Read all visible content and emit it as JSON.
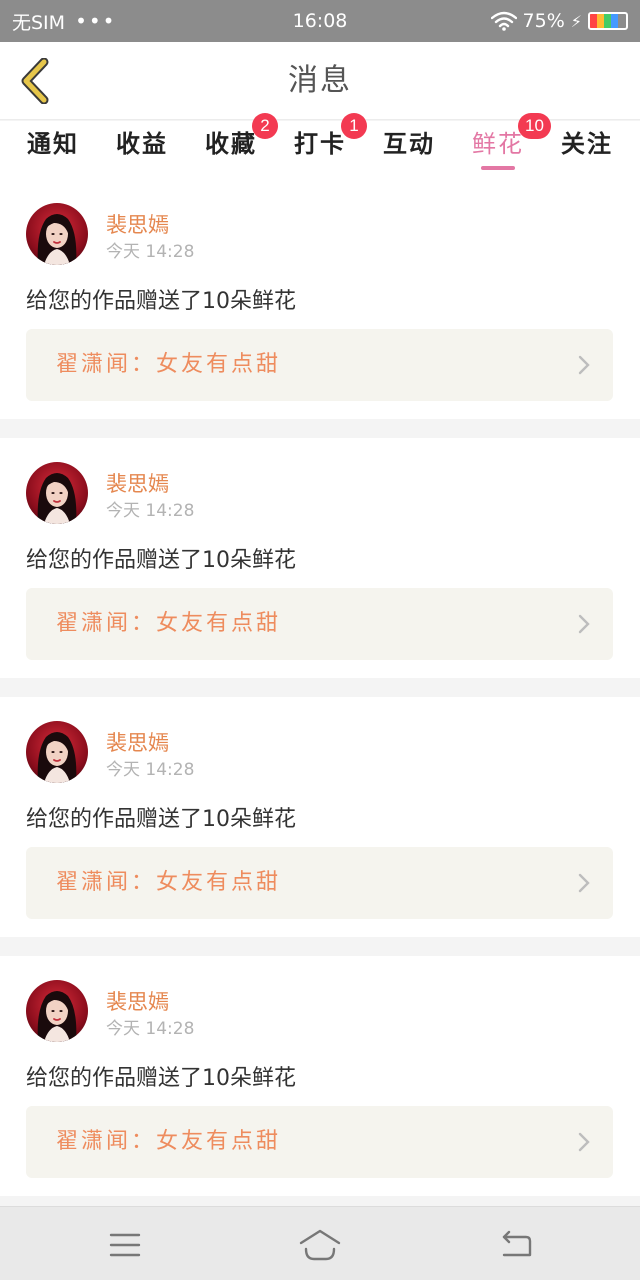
{
  "status_bar": {
    "carrier": "无SIM",
    "dots": "•••",
    "time": "16:08",
    "battery_percent": "75%"
  },
  "header": {
    "title": "消息",
    "back_icon": "chevron-left-icon"
  },
  "tabs": [
    {
      "label": "通知",
      "badge": ""
    },
    {
      "label": "收益",
      "badge": ""
    },
    {
      "label": "收藏",
      "badge": "2"
    },
    {
      "label": "打卡",
      "badge": "1"
    },
    {
      "label": "互动",
      "badge": ""
    },
    {
      "label": "鲜花",
      "badge": "10",
      "active": true
    },
    {
      "label": "关注",
      "badge": ""
    }
  ],
  "feed": [
    {
      "user": "裴思嫣",
      "time": "今天 14:28",
      "message": "给您的作品赠送了10朵鲜花",
      "work": "翟潇闻：女友有点甜"
    },
    {
      "user": "裴思嫣",
      "time": "今天 14:28",
      "message": "给您的作品赠送了10朵鲜花",
      "work": "翟潇闻：女友有点甜"
    },
    {
      "user": "裴思嫣",
      "time": "今天 14:28",
      "message": "给您的作品赠送了10朵鲜花",
      "work": "翟潇闻：女友有点甜"
    },
    {
      "user": "裴思嫣",
      "time": "今天 14:28",
      "message": "给您的作品赠送了10朵鲜花",
      "work": "翟潇闻：女友有点甜"
    }
  ],
  "colors": {
    "accent": "#e377a4",
    "username": "#e5874f",
    "work_link_text": "#ee8c5e",
    "badge": "#f33a52",
    "back_arrow": "#e6c64a"
  },
  "navbar": {
    "icons": [
      "menu-icon",
      "home-icon",
      "back-icon"
    ]
  }
}
